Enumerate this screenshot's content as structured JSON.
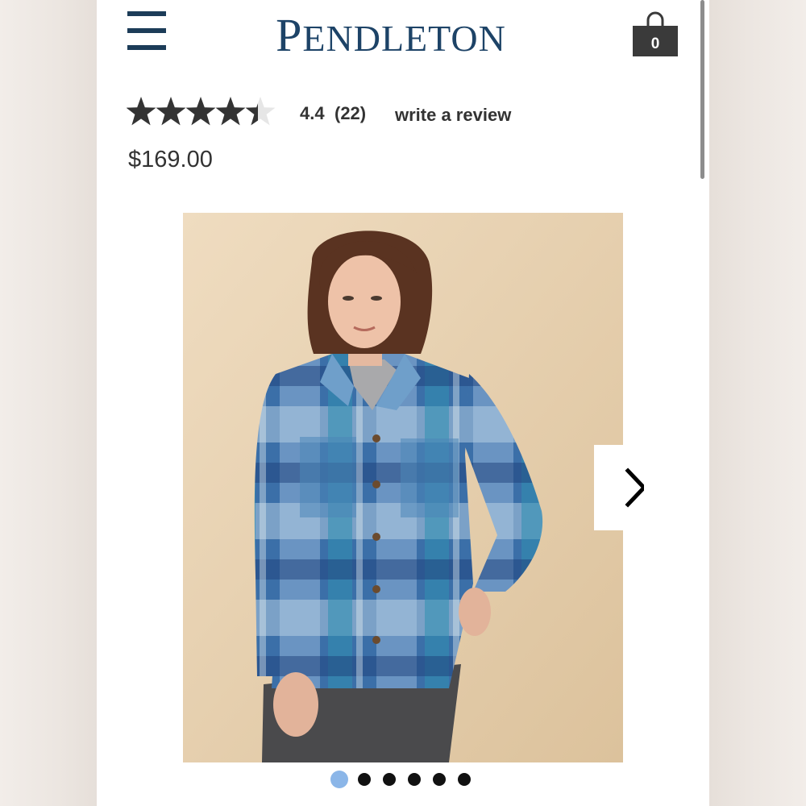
{
  "header": {
    "brand": "PENDLETON",
    "cart_count": "0"
  },
  "product": {
    "rating_value": "4.4",
    "rating_fraction": 0.88,
    "review_count": "(22)",
    "write_review_label": "write a review",
    "price": "$169.00"
  },
  "gallery": {
    "image_count": 6,
    "active_index": 0
  },
  "colors": {
    "brand_navy": "#1d4367",
    "text": "#333333",
    "star": "#333333",
    "active_dot": "#8bb6e8",
    "image_bg": "#e8d5b5",
    "plaid_blue": "#3b6fa8",
    "plaid_teal": "#2f8fb0"
  },
  "icons": {
    "menu": "hamburger-menu-icon",
    "cart": "shopping-bag-icon",
    "next": "chevron-right-icon"
  }
}
